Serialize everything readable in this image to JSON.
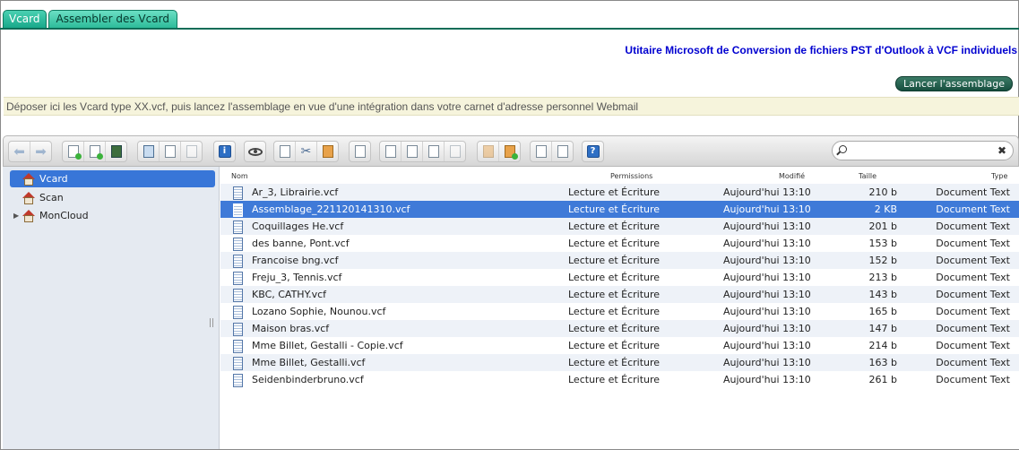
{
  "tabs": [
    "Vcard",
    "Assembler des Vcard"
  ],
  "header": {
    "title": "Utitaire Microsoft de Conversion de fichiers PST d'Outlook à VCF individuels",
    "assemble_button": "Lancer l'assemblage",
    "info": "Déposer ici les Vcard type XX.vcf, puis lancez l'assemblage en vue d'une intégration dans votre carnet d'adresse personnel Webmail"
  },
  "search": {
    "placeholder": "",
    "clear": "✖"
  },
  "sidebar": {
    "items": [
      {
        "label": "Vcard",
        "selected": true
      },
      {
        "label": "Scan",
        "selected": false
      },
      {
        "label": "MonCloud",
        "selected": false,
        "expandable": true
      }
    ]
  },
  "columns": [
    "Nom",
    "Permissions",
    "Modifié",
    "Taille",
    "Type"
  ],
  "files": [
    {
      "name": "Ar_3, Librairie.vcf",
      "permissions": "Lecture et Écriture",
      "modified": "Aujourd'hui 13:10",
      "size": "210 b",
      "type": "Document Text"
    },
    {
      "name": "Assemblage_221120141310.vcf",
      "permissions": "Lecture et Écriture",
      "modified": "Aujourd'hui 13:10",
      "size": "2 KB",
      "type": "Document Text"
    },
    {
      "name": "Coquillages He.vcf",
      "permissions": "Lecture et Écriture",
      "modified": "Aujourd'hui 13:10",
      "size": "201 b",
      "type": "Document Text"
    },
    {
      "name": "des banne, Pont.vcf",
      "permissions": "Lecture et Écriture",
      "modified": "Aujourd'hui 13:10",
      "size": "153 b",
      "type": "Document Text"
    },
    {
      "name": "Francoise bng.vcf",
      "permissions": "Lecture et Écriture",
      "modified": "Aujourd'hui 13:10",
      "size": "152 b",
      "type": "Document Text"
    },
    {
      "name": "Freju_3, Tennis.vcf",
      "permissions": "Lecture et Écriture",
      "modified": "Aujourd'hui 13:10",
      "size": "213 b",
      "type": "Document Text"
    },
    {
      "name": "KBC, CATHY.vcf",
      "permissions": "Lecture et Écriture",
      "modified": "Aujourd'hui 13:10",
      "size": "143 b",
      "type": "Document Text"
    },
    {
      "name": "Lozano Sophie, Nounou.vcf",
      "permissions": "Lecture et Écriture",
      "modified": "Aujourd'hui 13:10",
      "size": "165 b",
      "type": "Document Text"
    },
    {
      "name": "Maison bras.vcf",
      "permissions": "Lecture et Écriture",
      "modified": "Aujourd'hui 13:10",
      "size": "147 b",
      "type": "Document Text"
    },
    {
      "name": "Mme Billet, Gestalli - Copie.vcf",
      "permissions": "Lecture et Écriture",
      "modified": "Aujourd'hui 13:10",
      "size": "214 b",
      "type": "Document Text"
    },
    {
      "name": "Mme Billet, Gestalli.vcf",
      "permissions": "Lecture et Écriture",
      "modified": "Aujourd'hui 13:10",
      "size": "163 b",
      "type": "Document Text"
    },
    {
      "name": "Seidenbinderbruno.vcf",
      "permissions": "Lecture et Écriture",
      "modified": "Aujourd'hui 13:10",
      "size": "261 b",
      "type": "Document Text"
    }
  ],
  "selected_file_index": 1,
  "colors": {
    "tab": "#18a98a",
    "selection": "#3f7ad8",
    "title": "#0000d0",
    "button": "#174f3f"
  }
}
